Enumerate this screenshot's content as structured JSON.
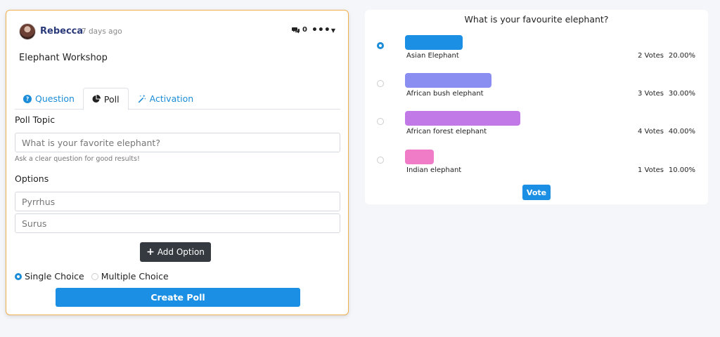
{
  "post": {
    "author": "Rebecca",
    "posted": "7 days ago",
    "comment_count": "0",
    "title": "Elephant Workshop"
  },
  "tabs": [
    {
      "label": "Question",
      "icon": "question-circle-icon"
    },
    {
      "label": "Poll",
      "icon": "pie-chart-icon"
    },
    {
      "label": "Activation",
      "icon": "magic-wand-icon"
    }
  ],
  "form": {
    "topic_label": "Poll Topic",
    "topic_placeholder": "What is your favorite elephant?",
    "topic_hint": "Ask a clear question for good results!",
    "options_label": "Options",
    "options": [
      "Pyrrhus",
      "Surus"
    ],
    "add_option_label": "Add Option",
    "single_choice_label": "Single Choice",
    "multiple_choice_label": "Multiple Choice",
    "create_label": "Create Poll"
  },
  "poll": {
    "question": "What is your favourite elephant?",
    "options": [
      {
        "name": "Asian Elephant",
        "votes": "2 Votes",
        "percent": "20.00%",
        "share": 0.2,
        "color": "#1a8fe3",
        "selected": true
      },
      {
        "name": "African bush elephant",
        "votes": "3 Votes",
        "percent": "30.00%",
        "share": 0.3,
        "color": "#8a8ef0",
        "selected": false
      },
      {
        "name": "African forest elephant",
        "votes": "4 Votes",
        "percent": "40.00%",
        "share": 0.4,
        "color": "#c279e8",
        "selected": false
      },
      {
        "name": "Indian elephant",
        "votes": "1 Votes",
        "percent": "10.00%",
        "share": 0.1,
        "color": "#f07cc8",
        "selected": false
      }
    ],
    "vote_label": "Vote"
  },
  "colors": {
    "accent": "#1a8fe3",
    "card_border": "#f0b050",
    "dark_button": "#343a40"
  }
}
